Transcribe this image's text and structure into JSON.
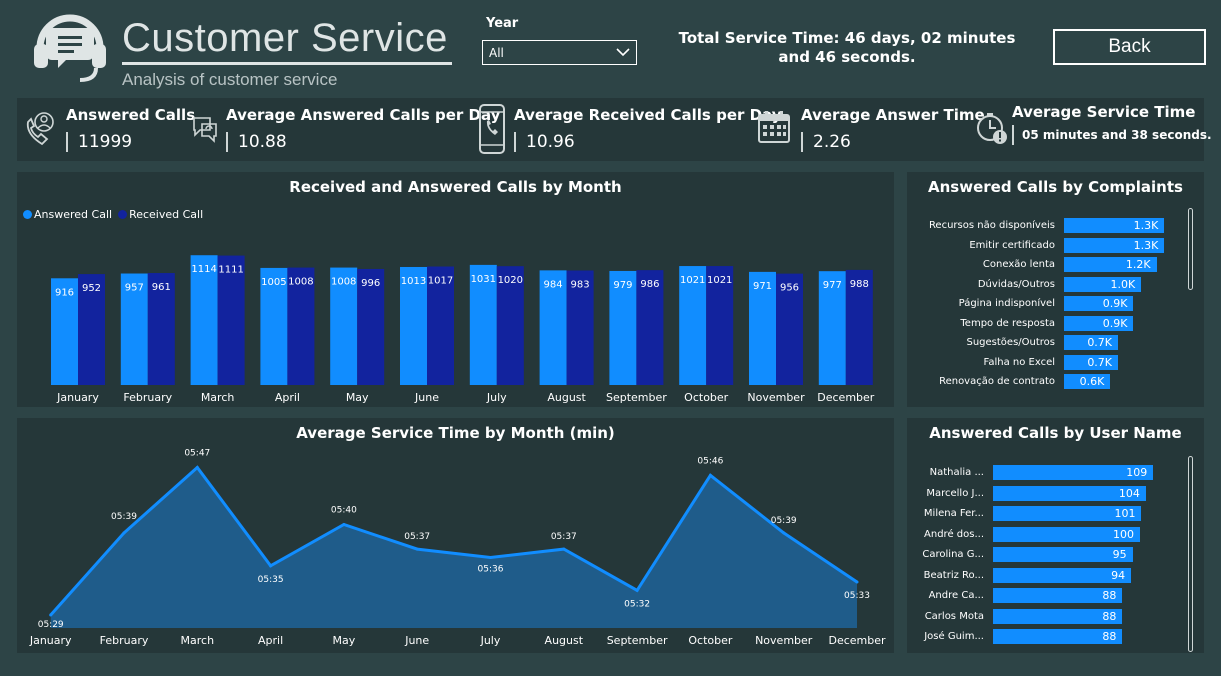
{
  "header": {
    "title": "Customer Service",
    "subtitle": "Analysis of customer service",
    "logo_icon": "headset-chat-icon"
  },
  "filter": {
    "label": "Year",
    "selected": "All"
  },
  "total_time": {
    "text": "Total Service Time: 46 days, 02 minutes and 46 seconds."
  },
  "back_button": {
    "label": "Back"
  },
  "kpis": [
    {
      "label": "Answered Calls",
      "value": "11999",
      "icon": "phone-user-icon"
    },
    {
      "label": "Average Answered Calls per Day",
      "value": "10.88",
      "icon": "chat-refresh-icon"
    },
    {
      "label": "Average Received Calls per Day",
      "value": "10.96",
      "icon": "mobile-phone-icon"
    },
    {
      "label": "Average Answer Time",
      "value": "2.26",
      "icon": "calendar-icon"
    },
    {
      "label": "Average Service Time",
      "value": "05 minutes and 38 seconds.",
      "icon": "clock-alert-icon"
    }
  ],
  "colors": {
    "background": "#2d4446",
    "panel": "#253739",
    "answered": "#118dff",
    "received": "#12239e",
    "area_fill": "#1f5c8a"
  },
  "chart_data": [
    {
      "type": "bar",
      "title": "Received and Answered Calls by Month",
      "categories": [
        "January",
        "February",
        "March",
        "April",
        "May",
        "June",
        "July",
        "August",
        "September",
        "October",
        "November",
        "December"
      ],
      "series": [
        {
          "name": "Answered Call",
          "values": [
            916,
            957,
            1114,
            1005,
            1008,
            1013,
            1031,
            984,
            979,
            1021,
            971,
            977
          ]
        },
        {
          "name": "Received Call",
          "values": [
            952,
            961,
            1111,
            1008,
            996,
            1017,
            1020,
            983,
            986,
            1021,
            956,
            988
          ]
        }
      ],
      "legend": "top-left"
    },
    {
      "type": "area",
      "title": "Average Service Time by Month (min)",
      "categories": [
        "January",
        "February",
        "March",
        "April",
        "May",
        "June",
        "July",
        "August",
        "September",
        "October",
        "November",
        "December"
      ],
      "values": [
        5.483,
        5.65,
        5.783,
        5.583,
        5.667,
        5.617,
        5.6,
        5.617,
        5.533,
        5.767,
        5.65,
        5.55
      ],
      "labels": [
        "05:29",
        "05:39",
        "05:47",
        "05:35",
        "05:40",
        "05:37",
        "05:36",
        "05:37",
        "05:32",
        "05:46",
        "05:39",
        "05:33"
      ]
    },
    {
      "type": "bar",
      "orientation": "horizontal",
      "title": "Answered Calls by Complaints",
      "categories": [
        "Recursos não disponíveis",
        "Emitir certificado",
        "Conexão lenta",
        "Dúvidas/Outros",
        "Página indisponível",
        "Tempo de resposta",
        "Sugestões/Outros",
        "Falha no Excel",
        "Renovação de contrato"
      ],
      "values": [
        1300,
        1300,
        1200,
        1000,
        900,
        900,
        700,
        700,
        600
      ],
      "labels": [
        "1.3K",
        "1.3K",
        "1.2K",
        "1.0K",
        "0.9K",
        "0.9K",
        "0.7K",
        "0.7K",
        "0.6K"
      ]
    },
    {
      "type": "bar",
      "orientation": "horizontal",
      "title": "Answered Calls by User Name",
      "categories": [
        "Nathalia ...",
        "Marcello J...",
        "Milena Fer...",
        "André dos...",
        "Carolina G...",
        "Beatriz Ro...",
        "Andre Ca...",
        "Carlos Mota",
        "José Guim..."
      ],
      "values": [
        109,
        104,
        101,
        100,
        95,
        94,
        88,
        88,
        88
      ]
    }
  ]
}
